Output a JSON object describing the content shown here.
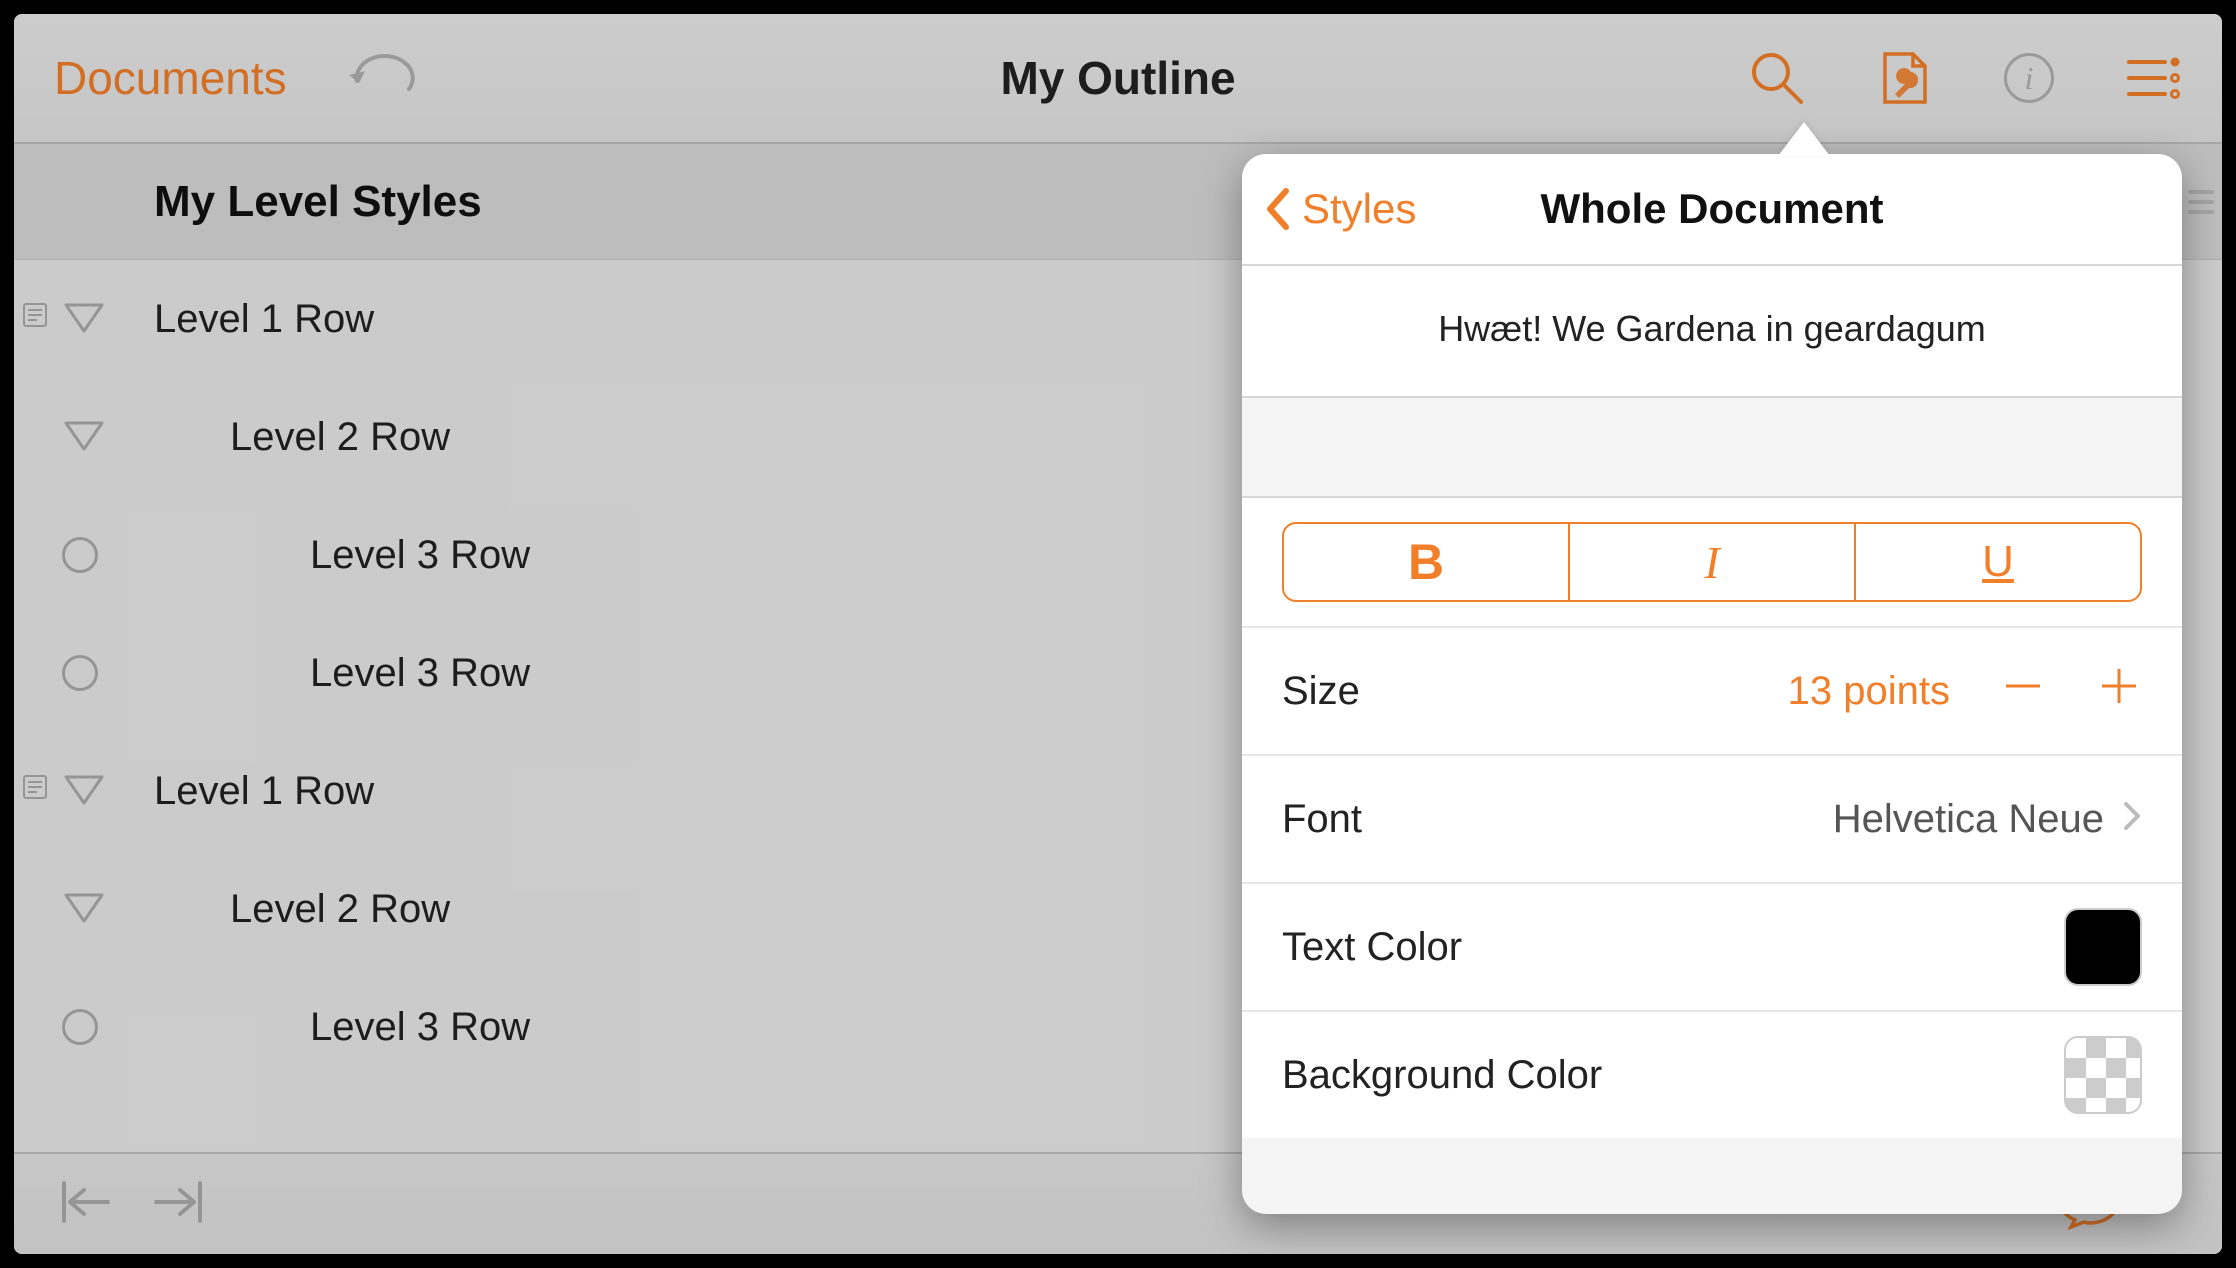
{
  "colors": {
    "accent": "#f17f2a",
    "text": "#222222",
    "muted": "#aaaaaa"
  },
  "toolbar": {
    "documents_label": "Documents",
    "title": "My Outline"
  },
  "outline": {
    "section_title": "My Level Styles",
    "rows": [
      {
        "level": 1,
        "text": "Level 1 Row",
        "hasNote": true,
        "disclosure": true
      },
      {
        "level": 2,
        "text": "Level 2 Row",
        "hasNote": false,
        "disclosure": true
      },
      {
        "level": 3,
        "text": "Level 3 Row",
        "hasNote": false,
        "disclosure": false
      },
      {
        "level": 3,
        "text": "Level 3 Row",
        "hasNote": false,
        "disclosure": false
      },
      {
        "level": 1,
        "text": "Level 1 Row",
        "hasNote": true,
        "disclosure": true
      },
      {
        "level": 2,
        "text": "Level 2 Row",
        "hasNote": false,
        "disclosure": true
      },
      {
        "level": 3,
        "text": "Level 3 Row",
        "hasNote": false,
        "disclosure": false
      }
    ]
  },
  "popover": {
    "back_label": "Styles",
    "title": "Whole Document",
    "preview_text": "Hwæt! We Gardena in geardagum",
    "biu": {
      "bold": "B",
      "italic": "I",
      "underline": "U"
    },
    "size": {
      "label": "Size",
      "value": "13 points"
    },
    "font": {
      "label": "Font",
      "value": "Helvetica Neue"
    },
    "text_color": {
      "label": "Text Color",
      "value": "#000000"
    },
    "background_color": {
      "label": "Background Color",
      "value": "transparent"
    }
  }
}
